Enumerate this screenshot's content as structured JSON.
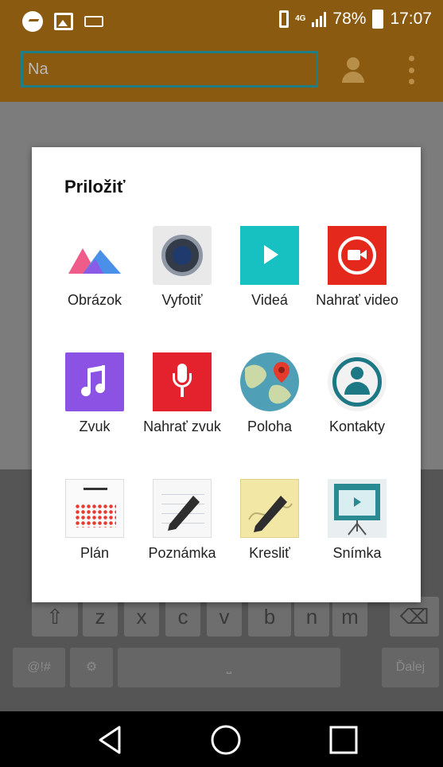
{
  "status_bar": {
    "battery": "78%",
    "time": "17:07",
    "network": "4G",
    "icons": [
      "messenger-icon",
      "image-icon",
      "keyboard-icon",
      "vibrate-icon",
      "signal-icon",
      "battery-icon"
    ]
  },
  "app_bar": {
    "to_placeholder": "Na"
  },
  "keyboard": {
    "row3": [
      "z",
      "x",
      "c",
      "v",
      "b",
      "n",
      "m"
    ],
    "lang_key": "@!#",
    "done_key": "Ďalej"
  },
  "dialog": {
    "title": "Priložiť",
    "items": [
      {
        "label": "Obrázok",
        "icon": "gallery-icon"
      },
      {
        "label": "Vyfotiť",
        "icon": "camera-icon"
      },
      {
        "label": "Videá",
        "icon": "video-play-icon"
      },
      {
        "label": "Nahrať video",
        "icon": "video-record-icon"
      },
      {
        "label": "Zvuk",
        "icon": "music-note-icon"
      },
      {
        "label": "Nahrať zvuk",
        "icon": "microphone-icon"
      },
      {
        "label": "Poloha",
        "icon": "map-location-icon"
      },
      {
        "label": "Kontakty",
        "icon": "contact-icon"
      },
      {
        "label": "Plán",
        "icon": "calendar-icon"
      },
      {
        "label": "Poznámka",
        "icon": "note-pen-icon"
      },
      {
        "label": "Kresliť",
        "icon": "drawing-icon"
      },
      {
        "label": "Snímka",
        "icon": "slide-icon"
      }
    ]
  },
  "nav_bar": {
    "icons": [
      "back-icon",
      "home-icon",
      "recent-apps-icon"
    ]
  },
  "colors": {
    "app_bar": "#8a5a10",
    "accent_teal": "#1c7885",
    "dialog_bg": "#ffffff",
    "nav_bar": "#000000"
  }
}
